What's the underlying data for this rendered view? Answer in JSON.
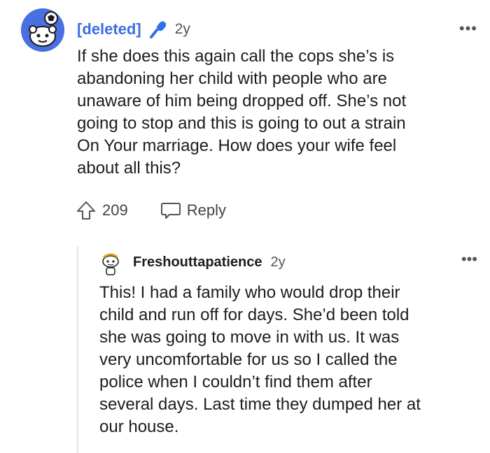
{
  "comment1": {
    "author": "[deleted]",
    "age": "2y",
    "more": "•••",
    "body": "If she does this again call the cops she’s is\nabandoning her child with people who are\nunaware of him being dropped off. She’s not\ngoing to stop and this is going to out a strain\nOn Your marriage. How does your wife feel\nabout all this?",
    "votes": "209",
    "reply_label": "Reply"
  },
  "comment2": {
    "author": "Freshouttapatience",
    "age": "2y",
    "more": "•••",
    "body": "This! I had a family who would drop their\nchild and run off for days. She’d been told\nshe was going to move in with us. It was\nvery uncomfortable for us so I called the\npolice when I couldn’t find them after\nseveral days. Last time they dumped her at\nour house."
  },
  "colors": {
    "author_deleted": "#3b6ee0",
    "avatar_bg": "#4a6fe0",
    "mic": "#2f6fe8"
  }
}
